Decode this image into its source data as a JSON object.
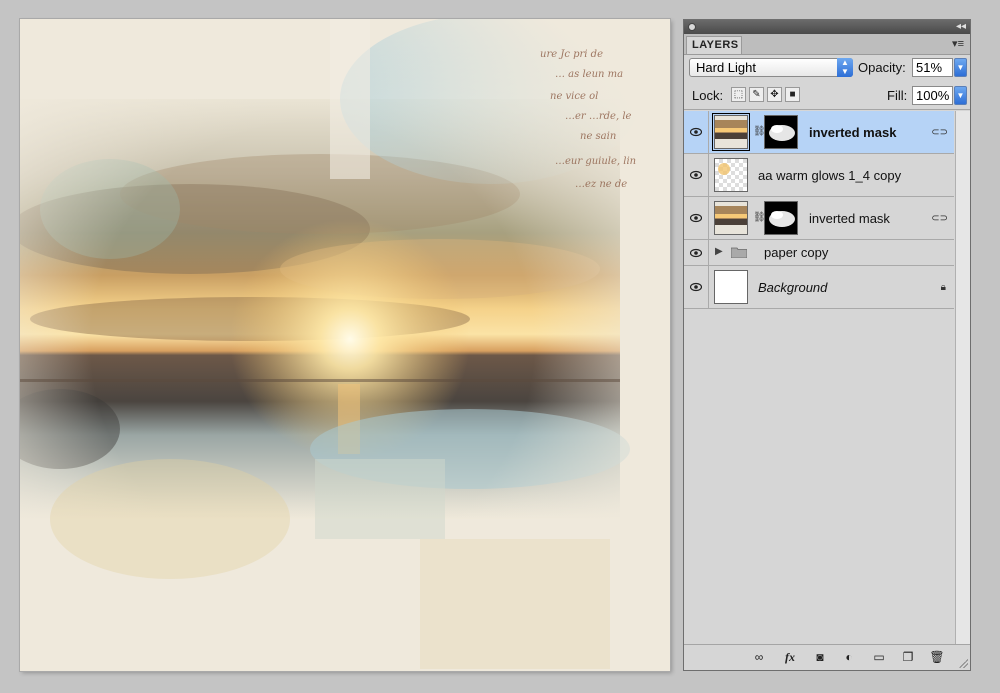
{
  "canvas": {
    "handwriting": [
      "ure Jc pri de",
      "… as leun ma",
      "ne vice ol",
      "…er …rde, le",
      "ne sain",
      "…eur guiule, lin",
      "…ez ne de"
    ]
  },
  "panel": {
    "tab_label": "LAYERS",
    "blend_mode": "Hard Light",
    "opacity_label": "Opacity:",
    "opacity_value": "51%",
    "lock_label": "Lock:",
    "fill_label": "Fill:",
    "fill_value": "100%",
    "layers": [
      {
        "name": "inverted mask",
        "selected": true
      },
      {
        "name": "aa warm glows 1_4 copy",
        "selected": false
      },
      {
        "name": "inverted mask",
        "selected": false
      },
      {
        "name": "paper copy",
        "selected": false
      },
      {
        "name": "Background",
        "selected": false
      }
    ]
  },
  "icons": [
    "eye-icon",
    "chain-link-icon",
    "lock-icon",
    "folder-icon",
    "fx-icon",
    "mask-icon",
    "adjustment-icon",
    "new-layer-icon",
    "trash-icon"
  ]
}
